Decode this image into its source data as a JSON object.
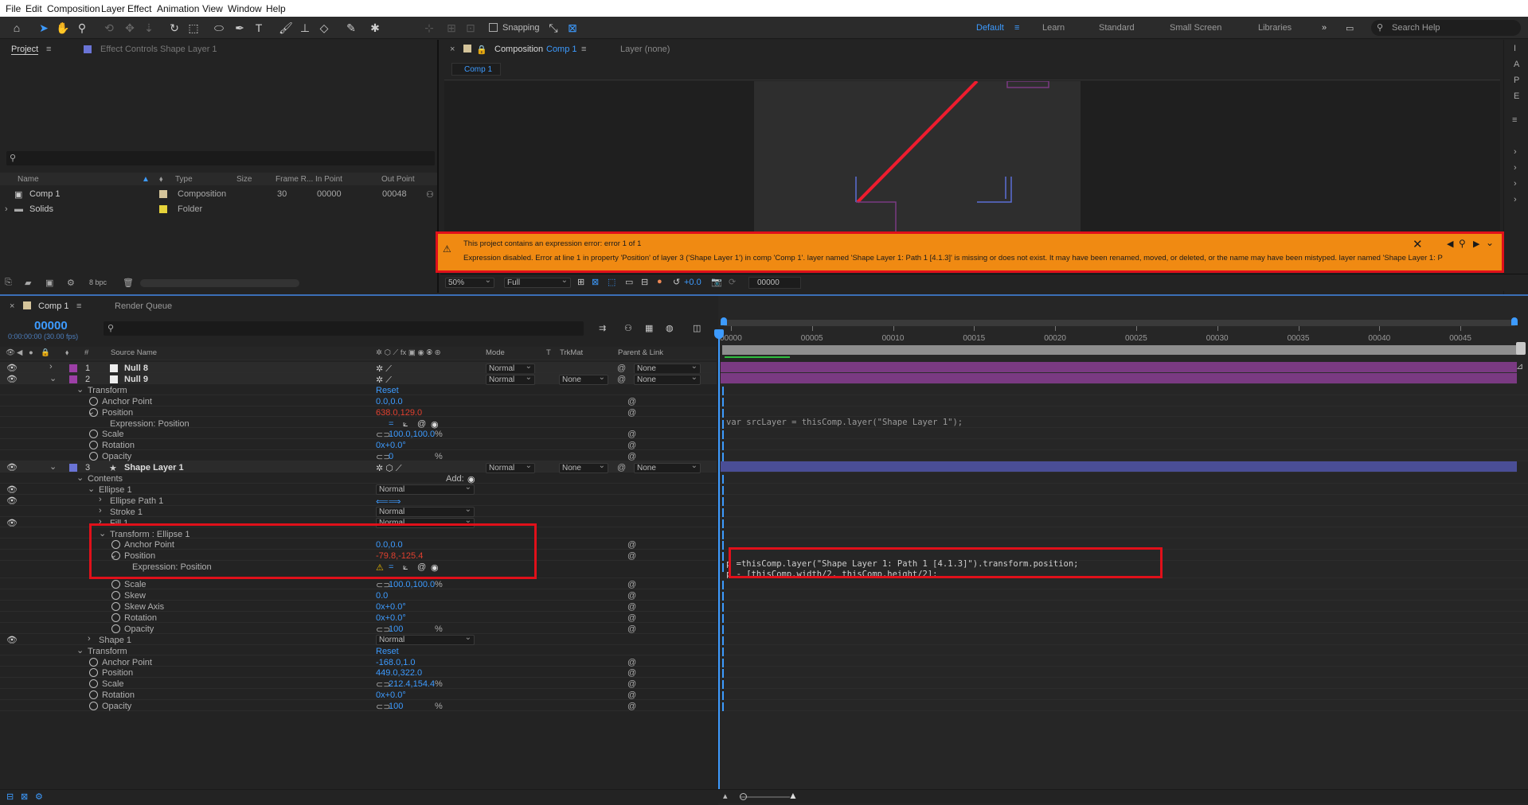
{
  "menu": [
    "File",
    "Edit",
    "Composition",
    "Layer",
    "Effect",
    "Animation",
    "View",
    "Window",
    "Help"
  ],
  "toolbar": {
    "snapping": "Snapping",
    "workspaces": [
      "Default",
      "Learn",
      "Standard",
      "Small Screen",
      "Libraries"
    ],
    "search_placeholder": "Search Help"
  },
  "project": {
    "tab": "Project",
    "effect_controls_tab": "Effect Controls Shape Layer 1",
    "columns": [
      "Name",
      "Type",
      "Size",
      "Frame R...",
      "In Point",
      "Out Point"
    ],
    "rows": [
      {
        "name": "Comp 1",
        "type": "Composition",
        "frame_rate": "30",
        "in": "00000",
        "out": "00048"
      },
      {
        "name": "Solids",
        "type": "Folder",
        "frame_rate": "",
        "in": "",
        "out": ""
      }
    ],
    "bpc": "8 bpc"
  },
  "viewer": {
    "tab": "Composition",
    "tab_comp": "Comp 1",
    "layer_tab": "Layer (none)",
    "subtab": "Comp 1",
    "zoom": "50%",
    "resolution": "Full",
    "exposure": "+0.0",
    "timecode": "00000"
  },
  "error": {
    "line1": "This project contains an expression error: error 1 of 1",
    "line2": "Expression disabled. Error at line 1 in property 'Position' of layer 3 ('Shape Layer 1') in comp 'Comp 1'. layer named 'Shape Layer 1: Path 1 [4.1.3]' is missing or does not exist. It may have been renamed, moved, or deleted, or the name may have been mistyped. layer named 'Shape Layer 1: P"
  },
  "timeline": {
    "tab": "Comp 1",
    "render_queue": "Render Queue",
    "current_time": "00000",
    "current_time_sub": "0:00:00:00 (30.00 fps)",
    "headers": {
      "source_name": "Source Name",
      "mode": "Mode",
      "t": "T",
      "trkmat": "TrkMat",
      "parent": "Parent & Link"
    },
    "ruler_ticks": [
      "00000",
      "00005",
      "00010",
      "00015",
      "00020",
      "00025",
      "00030",
      "00035",
      "00040",
      "00045"
    ],
    "rows": [
      {
        "num": "1",
        "label": "Null 8",
        "mode": "Normal",
        "trkmat": "",
        "parent": "None"
      },
      {
        "num": "2",
        "label": "Null 9",
        "mode": "Normal",
        "trkmat": "None",
        "parent": "None"
      },
      {
        "label": "Transform",
        "value": "Reset"
      },
      {
        "label": "Anchor Point",
        "value": "0.0,0.0"
      },
      {
        "label": "Position",
        "value": "638.0,129.0"
      },
      {
        "label": "Expression: Position"
      },
      {
        "label": "Scale",
        "value": "100.0,100.0",
        "unit": "%"
      },
      {
        "label": "Rotation",
        "value": "0x+0.0°"
      },
      {
        "label": "Opacity",
        "value": "0",
        "unit": "%"
      },
      {
        "num": "3",
        "label": "Shape Layer 1",
        "mode": "Normal",
        "trkmat": "None",
        "parent": "None"
      },
      {
        "label": "Contents",
        "value": "Add:"
      },
      {
        "label": "Ellipse 1",
        "value": "Normal"
      },
      {
        "label": "Ellipse Path 1"
      },
      {
        "label": "Stroke 1",
        "value": "Normal"
      },
      {
        "label": "Fill 1",
        "value": "Normal"
      },
      {
        "label": "Transform : Ellipse 1"
      },
      {
        "label": "Anchor Point",
        "value": "0.0,0.0"
      },
      {
        "label": "Position",
        "value": "-79.8,-125.4"
      },
      {
        "label": "Expression: Position"
      },
      {
        "label": "Scale",
        "value": "100.0,100.0",
        "unit": "%"
      },
      {
        "label": "Skew",
        "value": "0.0"
      },
      {
        "label": "Skew Axis",
        "value": "0x+0.0°"
      },
      {
        "label": "Rotation",
        "value": "0x+0.0°"
      },
      {
        "label": "Opacity",
        "value": "100",
        "unit": "%"
      },
      {
        "label": "Shape 1",
        "value": "Normal"
      },
      {
        "label": "Transform",
        "value": "Reset"
      },
      {
        "label": "Anchor Point",
        "value": "-168.0,1.0"
      },
      {
        "label": "Position",
        "value": "449.0,322.0"
      },
      {
        "label": "Scale",
        "value": "212.4,154.4",
        "unit": "%"
      },
      {
        "label": "Rotation",
        "value": "0x+0.0°"
      },
      {
        "label": "Opacity",
        "value": "100",
        "unit": "%"
      }
    ],
    "expr1": "var srcLayer = thisComp.layer(\"Shape Layer 1\");",
    "expr2_line1": "p =thisComp.layer(\"Shape Layer 1: Path 1 [4.1.3]\").transform.position;",
    "expr2_line2": "p - [thisComp.width/2, thisComp.height/2];"
  },
  "colors": {
    "accent": "#3d9bff",
    "error_bg": "#f08a12",
    "highlight": "#e0101a",
    "null_bar": "#7a3a82",
    "shape_bar": "#4a4e96"
  }
}
